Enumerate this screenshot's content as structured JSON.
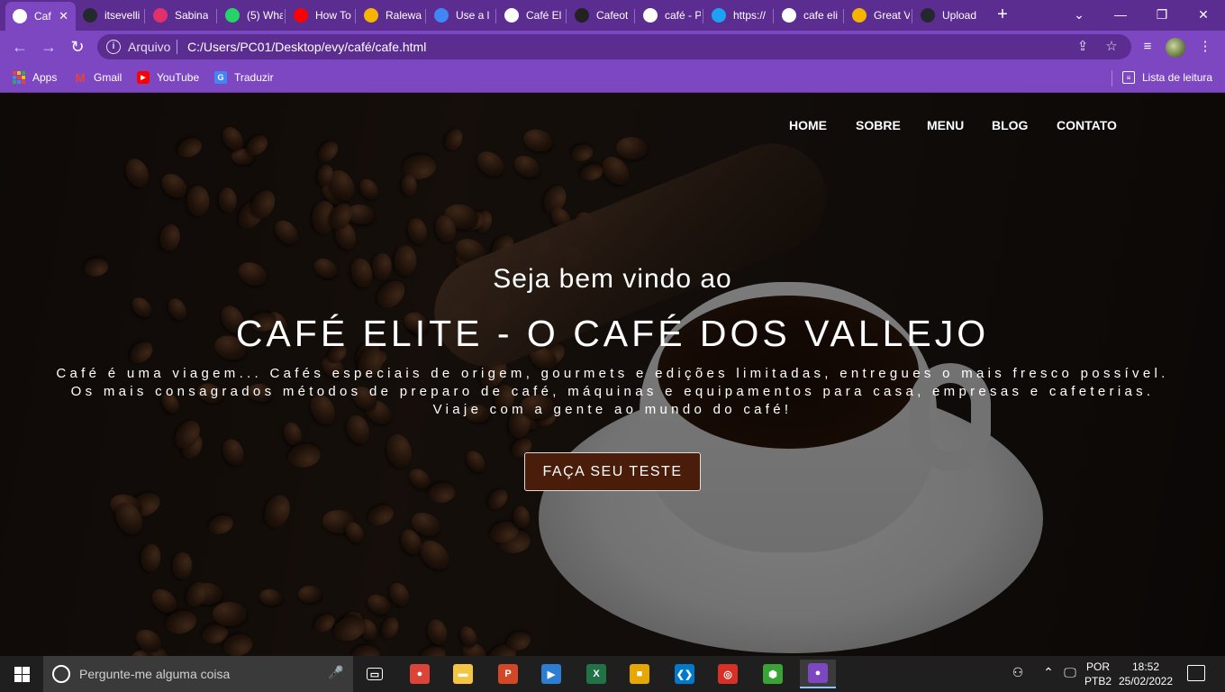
{
  "browser": {
    "tabs": [
      {
        "title": "Caf",
        "icon": "globe-icon",
        "color": "#ffffff",
        "active": true
      },
      {
        "title": "itsevelli",
        "icon": "github-icon",
        "color": "#24292e"
      },
      {
        "title": "Sabina",
        "icon": "instagram-icon",
        "color": "#e1306c"
      },
      {
        "title": "(5) Wha",
        "icon": "whatsapp-icon",
        "color": "#25d366"
      },
      {
        "title": "How To",
        "icon": "youtube-icon",
        "color": "#ff0000"
      },
      {
        "title": "Ralewa",
        "icon": "rainbow-icon",
        "color": "#f4b400"
      },
      {
        "title": "Use a l",
        "icon": "flag-icon",
        "color": "#4285f4"
      },
      {
        "title": "Café El",
        "icon": "globe-icon",
        "color": "#ffffff"
      },
      {
        "title": "Cafeot",
        "icon": "c-icon",
        "color": "#222222"
      },
      {
        "title": "café - P",
        "icon": "google-icon",
        "color": "#ffffff"
      },
      {
        "title": "https://",
        "icon": "twitter-icon",
        "color": "#1da1f2"
      },
      {
        "title": "cafe eli",
        "icon": "google-icon",
        "color": "#ffffff"
      },
      {
        "title": "Great V",
        "icon": "rainbow-icon",
        "color": "#f4b400"
      },
      {
        "title": "Upload",
        "icon": "github-icon",
        "color": "#24292e"
      }
    ],
    "address": {
      "scheme_label": "Arquivo",
      "url": "C:/Users/PC01/Desktop/evy/café/cafe.html"
    },
    "bookmarks": [
      {
        "label": "Apps",
        "icon": "apps-grid-icon"
      },
      {
        "label": "Gmail",
        "icon": "gmail-icon"
      },
      {
        "label": "YouTube",
        "icon": "youtube-icon"
      },
      {
        "label": "Traduzir",
        "icon": "translate-icon"
      }
    ],
    "reading_list": "Lista de leitura",
    "colors": {
      "frame": "#5b2d91",
      "toolbar": "#7e47c2"
    }
  },
  "page": {
    "nav": [
      "HOME",
      "SOBRE",
      "MENU",
      "BLOG",
      "CONTATO"
    ],
    "hero": {
      "subtitle": "Seja bem vindo ao",
      "title": "CAFÉ ELITE - O CAFÉ DOS VALLEJO",
      "text_lines": [
        "Café é uma viagem... Cafés especiais de origem, gourmets e edições limitadas, entregues o mais fresco possível.",
        "Os mais consagrados métodos de preparo de café, máquinas e equipamentos para casa, empresas e cafeterias.",
        "Viaje com a gente ao mundo do café!"
      ],
      "cta": "FAÇA SEU TESTE",
      "cta_color": "#4a1d0b"
    }
  },
  "taskbar": {
    "search_placeholder": "Pergunte-me alguma coisa",
    "apps": [
      {
        "name": "task-view-icon",
        "color": "#1f1f1f",
        "glyph": "▭"
      },
      {
        "name": "chrome-icon",
        "color": "#db4437",
        "glyph": "●"
      },
      {
        "name": "file-explorer-icon",
        "color": "#f4c542",
        "glyph": "▬"
      },
      {
        "name": "powerpoint-icon",
        "color": "#d24726",
        "glyph": "P"
      },
      {
        "name": "media-player-icon",
        "color": "#2d7dd2",
        "glyph": "▶"
      },
      {
        "name": "excel-icon",
        "color": "#217346",
        "glyph": "X"
      },
      {
        "name": "office-icon",
        "color": "#e6a700",
        "glyph": "■"
      },
      {
        "name": "vscode-icon",
        "color": "#007acc",
        "glyph": "❮❯"
      },
      {
        "name": "app-red-icon",
        "color": "#d93025",
        "glyph": "◎"
      },
      {
        "name": "app-green-cube-icon",
        "color": "#3aa335",
        "glyph": "⬢"
      },
      {
        "name": "chrome-profile-icon",
        "color": "#7e47c2",
        "glyph": "●"
      }
    ],
    "language": {
      "top": "POR",
      "bottom": "PTB2"
    },
    "time": "18:52",
    "date": "25/02/2022"
  }
}
